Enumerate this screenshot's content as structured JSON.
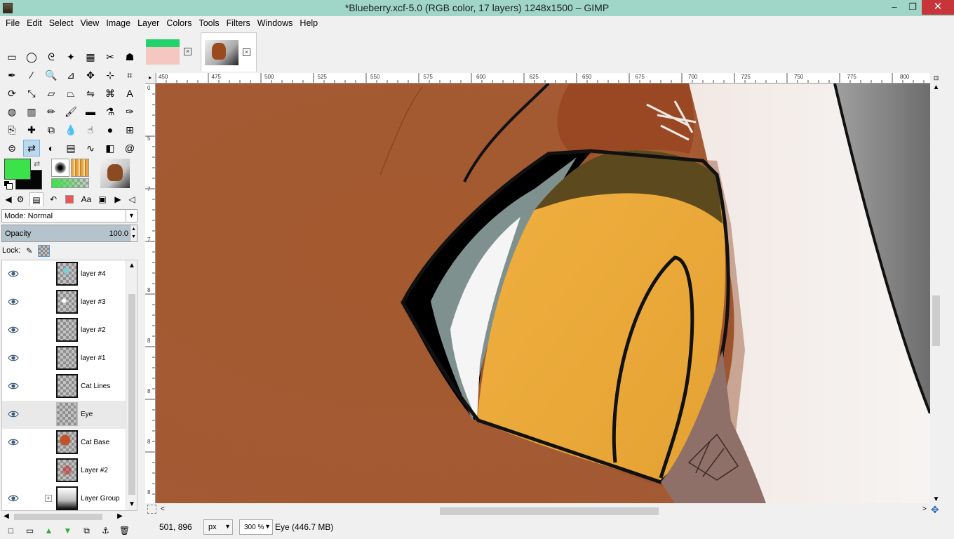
{
  "window": {
    "title": "*Blueberry.xcf-5.0 (RGB color, 17 layers) 1248x1500 – GIMP",
    "minimize": "–",
    "maximize": "❐",
    "close": "✕"
  },
  "menu": [
    "File",
    "Edit",
    "Select",
    "View",
    "Image",
    "Layer",
    "Colors",
    "Tools",
    "Filters",
    "Windows",
    "Help"
  ],
  "tools": [
    "rect-select",
    "ellipse-select",
    "free-select",
    "fuzzy-select",
    "select-by-color",
    "scissors-select",
    "foreground-select",
    "paths",
    "color-picker",
    "zoom",
    "measure",
    "move",
    "align",
    "crop",
    "rotate",
    "scale",
    "shear",
    "perspective",
    "flip",
    "cage-transform",
    "text",
    "bucket-fill",
    "blend",
    "pencil",
    "paintbrush",
    "eraser",
    "airbrush",
    "ink",
    "clone",
    "heal",
    "perspective-clone",
    "blur-sharpen",
    "smudge",
    "dodge-burn",
    "unified-transform",
    "mypaint-brush",
    "warp-transform",
    "color-balance",
    "levels",
    "curves",
    "threshold",
    "spiral"
  ],
  "colors": {
    "foreground": "#3ce24a",
    "background": "#050505"
  },
  "layer_mode": "Mode: Normal",
  "opacity": {
    "label": "Opacity",
    "value": "100.0",
    "fill_fraction": 1.0
  },
  "lock": {
    "label": "Lock:"
  },
  "layers": [
    {
      "name": "layer #4",
      "visible": true,
      "thumb": "cyan"
    },
    {
      "name": "layer #3",
      "visible": true,
      "thumb": "white"
    },
    {
      "name": "layer #2",
      "visible": true,
      "thumb": "empty"
    },
    {
      "name": "layer #1",
      "visible": true,
      "thumb": "empty"
    },
    {
      "name": "Cat Lines",
      "visible": true,
      "thumb": "empty"
    },
    {
      "name": "Eye",
      "visible": true,
      "thumb": "empty",
      "active": true
    },
    {
      "name": "Cat Base",
      "visible": true,
      "thumb": "cat"
    },
    {
      "name": "Layer #2",
      "visible": false,
      "thumb": "red"
    },
    {
      "name": "Layer Group",
      "visible": true,
      "thumb": "group",
      "expander": "+"
    }
  ],
  "image_tabs": [
    {
      "name": "image-tab-1",
      "active": false
    },
    {
      "name": "image-tab-blueberry",
      "active": true
    }
  ],
  "ruler": {
    "h_labels": [
      "450",
      "475",
      "500",
      "525",
      "550",
      "575",
      "600",
      "625",
      "650",
      "675",
      "700",
      "725",
      "750",
      "775",
      "800"
    ],
    "v_labels": [
      "0",
      "5",
      "7",
      "7",
      "8",
      "8",
      "8",
      "8",
      "8",
      "9"
    ]
  },
  "status": {
    "coords": "501, 896",
    "unit": "px",
    "zoom": "300 %",
    "message": "Eye (446.7 MB)"
  }
}
